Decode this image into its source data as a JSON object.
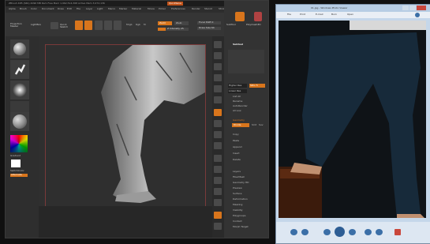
{
  "zbrush": {
    "title_text": "ZBrush 4R5 (64b) 4096 MB Ram  Free Mem 1,962,514,368  Active Mem 3,072,136",
    "quick_save_label": "QuickSave",
    "menu_items": [
      "Alpha",
      "Brush",
      "Color",
      "Document",
      "Draw",
      "Edit",
      "File",
      "Layer",
      "Light",
      "Macro",
      "Marker",
      "Material",
      "Movie",
      "Picker",
      "Preferences",
      "Render",
      "Stencil",
      "Stroke",
      "Texture",
      "Tool",
      "Transform",
      "Zplugin",
      "Zscript"
    ],
    "shelf": {
      "projection_label": "Projection Master",
      "lightbox_label": "LightBox",
      "quick_sketch_label": "Quick Sketch",
      "edit_label": "Edit",
      "draw_label": "Draw",
      "move_label": "Move",
      "scale_label": "Scale",
      "rotate_label": "Rotate",
      "mrgb_label": "Mrgb",
      "rgb_label": "Rgb",
      "m_label": "M",
      "zadd_label": "Zadd",
      "zsub_label": "Zsub",
      "focal_label": "Focal Shift 0",
      "draw_size_label": "Draw Size 64",
      "rgb_intensity_label": "Rgb Intensity 100",
      "z_intensity_label": "Z Intensity 25"
    },
    "left_panel": {
      "gradient_label": "Gradient",
      "switch_label": "SwitchColor",
      "alternate_label": "Alternate"
    },
    "tray": {
      "header_labels": [
        "SubTool",
        "Polymesh3D",
        "SimpleBrush"
      ],
      "subtool_title": "Subtool",
      "rows": [
        "List All",
        "Rename",
        "AutoReorder",
        "All Low",
        "All High",
        "Copy",
        "Paste",
        "Append",
        "Insert",
        "Delete",
        "Del Other",
        "Del All",
        "Split",
        "Merge",
        "Remesh",
        "Project",
        "Extract",
        "Geometry",
        "Layers",
        "FiberMesh",
        "Geometry HD",
        "Preview",
        "Surface",
        "Deformation",
        "Masking",
        "Visibility",
        "Polygroups",
        "Contact",
        "Morph Target"
      ],
      "higher_res_label": "Higher Res",
      "lower_res_label": "Lower Res",
      "divide_label": "Divide",
      "smt_label": "Smt",
      "suv_label": "Suv",
      "sdiv_label": "SDiv 5"
    },
    "colors": {
      "accent": "#d8751c",
      "canvas": "#2f2f2f",
      "panel": "#333333"
    }
  },
  "photo_viewer": {
    "title": "01.jpg - Windows Photo Viewer",
    "menu": [
      "File",
      "Print",
      "E-mail",
      "Burn",
      "Open"
    ],
    "controls": [
      "previous-icon",
      "slideshow-icon",
      "next-icon",
      "rotate-left-icon",
      "rotate-right-icon",
      "delete-icon"
    ],
    "colors": {
      "frame": "#c5d7ea",
      "photo_bg": "#0f1317"
    }
  }
}
